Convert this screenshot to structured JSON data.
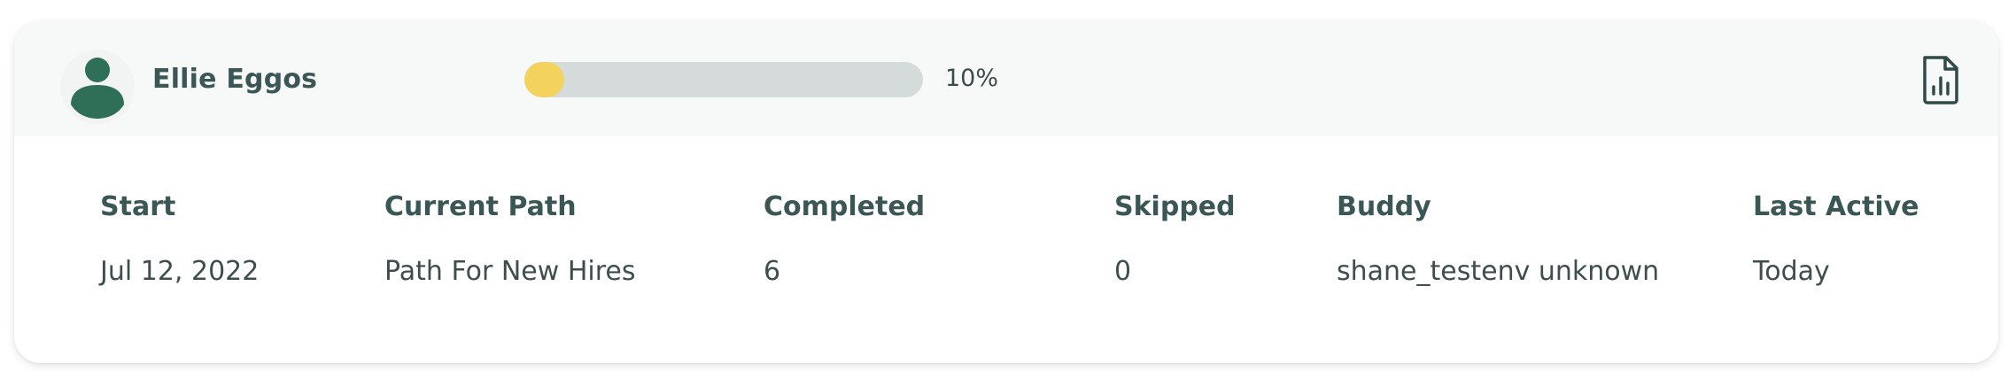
{
  "user": {
    "name": "Ellie Eggos"
  },
  "progress": {
    "value": 0.1,
    "label": "10%"
  },
  "icons": {
    "avatar": "user-avatar-icon",
    "report": "file-report-chart-icon"
  },
  "colors": {
    "accent_green": "#2f6f58",
    "progress_fill": "#f3d25e",
    "progress_track": "#d4dbda"
  },
  "details": {
    "columns": [
      {
        "header": "Start",
        "value": "Jul 12, 2022"
      },
      {
        "header": "Current Path",
        "value": "Path For New Hires"
      },
      {
        "header": "Completed",
        "value": "6"
      },
      {
        "header": "Skipped",
        "value": "0"
      },
      {
        "header": "Buddy",
        "value": "shane_testenv unknown"
      },
      {
        "header": "Last Active",
        "value": "Today"
      }
    ]
  }
}
